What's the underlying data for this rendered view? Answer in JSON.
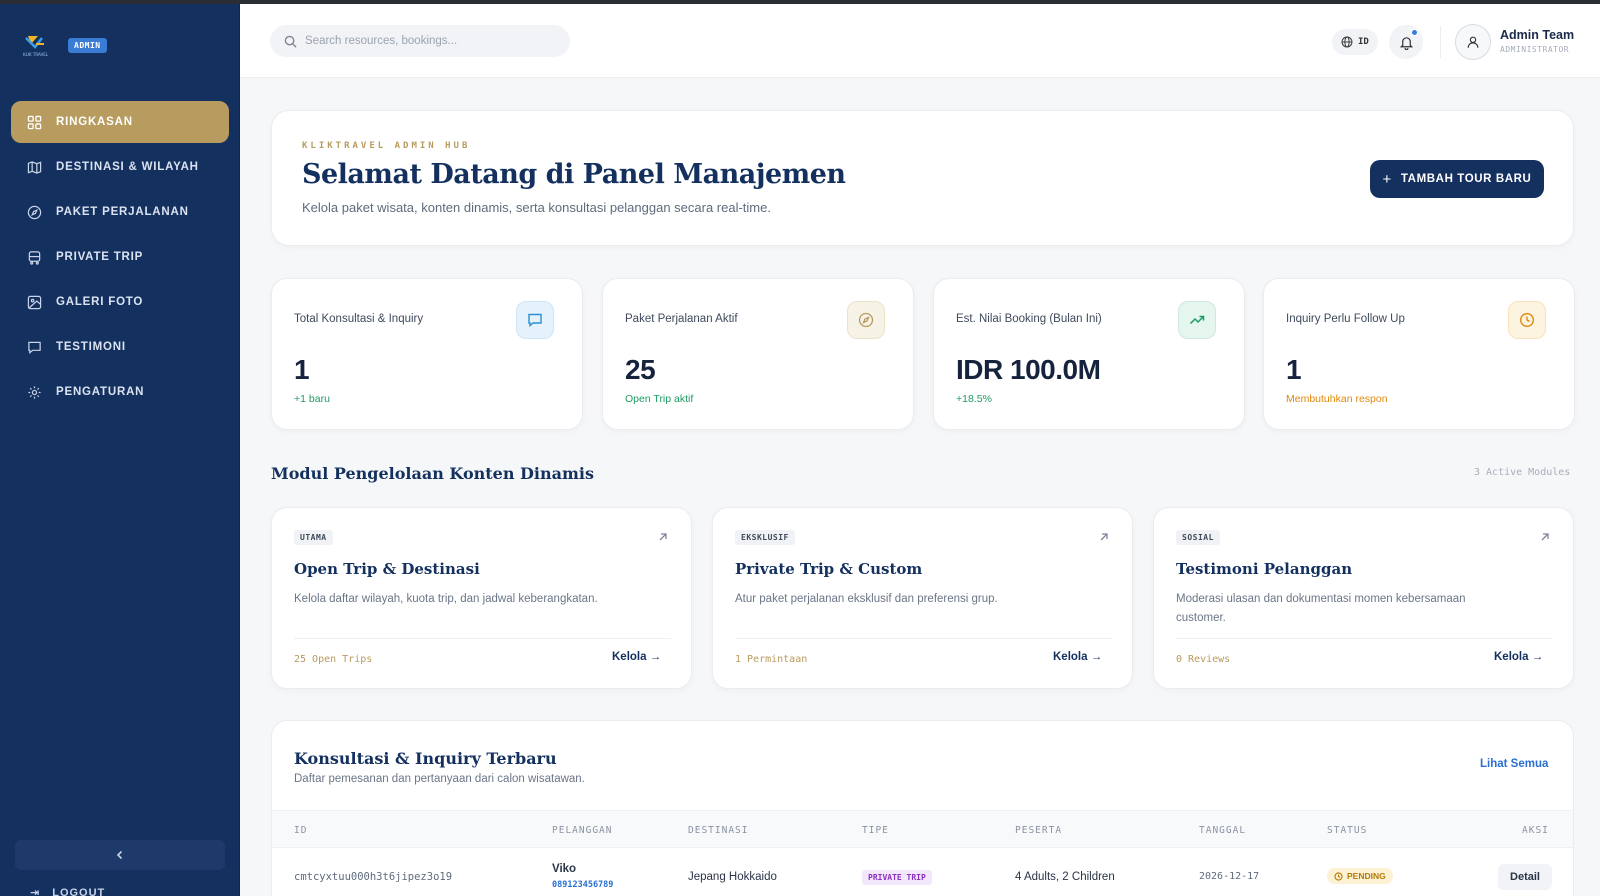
{
  "brand": {
    "logo_text": "KLIK TRAVEL",
    "badge": "ADMIN"
  },
  "sidebar": {
    "items": [
      {
        "label": "RINGKASAN",
        "icon": "dashboard-grid-icon",
        "active": true
      },
      {
        "label": "DESTINASI & WILAYAH",
        "icon": "map-icon"
      },
      {
        "label": "PAKET PERJALANAN",
        "icon": "compass-icon"
      },
      {
        "label": "PRIVATE TRIP",
        "icon": "bus-icon"
      },
      {
        "label": "GALERI FOTO",
        "icon": "image-icon"
      },
      {
        "label": "TESTIMONI",
        "icon": "message-square-icon"
      },
      {
        "label": "PENGATURAN",
        "icon": "gear-icon"
      }
    ],
    "logout_label": "LOGOUT"
  },
  "topbar": {
    "search_placeholder": "Search resources, bookings...",
    "lang": "ID",
    "user_name": "Admin Team",
    "user_role": "ADMINISTRATOR"
  },
  "hero": {
    "eyebrow": "KLIKTRAVEL ADMIN HUB",
    "title": "Selamat Datang di Panel Manajemen",
    "subtitle": "Kelola paket wisata, konten dinamis, serta konsultasi pelanggan secara real-time.",
    "button_label": "TAMBAH TOUR BARU"
  },
  "stats": [
    {
      "label": "Total Konsultasi & Inquiry",
      "value": "1",
      "sub": "+1 baru",
      "icon": "chat-icon",
      "accent": "#2a8fd6"
    },
    {
      "label": "Paket Perjalanan Aktif",
      "value": "25",
      "sub": "Open Trip aktif",
      "icon": "compass-icon",
      "accent": "#b89b5e"
    },
    {
      "label": "Est. Nilai Booking (Bulan Ini)",
      "value": "IDR 100.0M",
      "sub": "+18.5%",
      "icon": "trending-up-icon",
      "accent": "#1c9c63"
    },
    {
      "label": "Inquiry Perlu Follow Up",
      "value": "1",
      "sub": "Membutuhkan respon",
      "icon": "clock-icon",
      "accent": "#e08a0c"
    }
  ],
  "modules_section": {
    "title": "Modul Pengelolaan Konten Dinamis",
    "meta": "3 Active Modules"
  },
  "modules": [
    {
      "tag": "UTAMA",
      "title": "Open Trip & Destinasi",
      "desc": "Kelola daftar wilayah, kuota trip, dan jadwal keberangkatan.",
      "count": "25 Open Trips",
      "link": "Kelola →"
    },
    {
      "tag": "EKSKLUSIF",
      "title": "Private Trip & Custom",
      "desc": "Atur paket perjalanan eksklusif dan preferensi grup.",
      "count": "1 Permintaan",
      "link": "Kelola →"
    },
    {
      "tag": "SOSIAL",
      "title": "Testimoni Pelanggan",
      "desc": "Moderasi ulasan dan dokumentasi momen kebersamaan customer.",
      "count": "0 Reviews",
      "link": "Kelola →"
    }
  ],
  "inquiry": {
    "title": "Konsultasi & Inquiry Terbaru",
    "subtitle": "Daftar pemesanan dan pertanyaan dari calon wisatawan.",
    "link": "Lihat Semua",
    "columns": [
      "ID",
      "PELANGGAN",
      "DESTINASI",
      "TIPE",
      "PESERTA",
      "TANGGAL",
      "STATUS",
      "AKSI"
    ],
    "rows": [
      {
        "id": "cmtcyxtuu000h3t6jipez3o19",
        "customer": "Viko",
        "phone": "089123456789",
        "destination": "Jepang Hokkaido",
        "type": "PRIVATE TRIP",
        "participants": "4 Adults, 2 Children",
        "date": "2026-12-17",
        "status": "PENDING",
        "action": "Detail"
      }
    ]
  }
}
